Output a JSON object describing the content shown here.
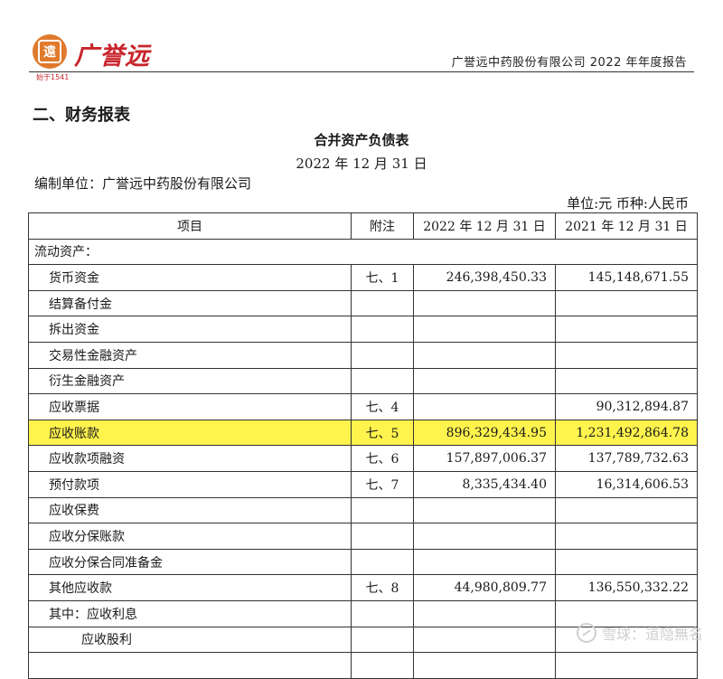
{
  "header": {
    "logo_mark": "遠",
    "logo_text": "广誉远",
    "logo_est": "始于1541",
    "report_title": "广誉远中药股份有限公司 2022 年年度报告"
  },
  "section_title": "二、财务报表",
  "document": {
    "title": "合并资产负债表",
    "date": "2022 年 12 月 31 日",
    "unit_line": "编制单位：广誉远中药股份有限公司",
    "currency_line": "单位:元  币种:人民币"
  },
  "table": {
    "headers": [
      "项目",
      "附注",
      "2022 年 12 月 31 日",
      "2021 年 12 月 31 日"
    ],
    "rows": [
      {
        "item": "流动资产：",
        "note": "",
        "v2022": "",
        "v2021": "",
        "kind": "section"
      },
      {
        "item": "货币资金",
        "note": "七、1",
        "v2022": "246,398,450.33",
        "v2021": "145,148,671.55",
        "kind": "normal"
      },
      {
        "item": "结算备付金",
        "note": "",
        "v2022": "",
        "v2021": "",
        "kind": "normal"
      },
      {
        "item": "拆出资金",
        "note": "",
        "v2022": "",
        "v2021": "",
        "kind": "normal"
      },
      {
        "item": "交易性金融资产",
        "note": "",
        "v2022": "",
        "v2021": "",
        "kind": "normal"
      },
      {
        "item": "衍生金融资产",
        "note": "",
        "v2022": "",
        "v2021": "",
        "kind": "normal"
      },
      {
        "item": "应收票据",
        "note": "七、4",
        "v2022": "",
        "v2021": "90,312,894.87",
        "kind": "normal"
      },
      {
        "item": "应收账款",
        "note": "七、5",
        "v2022": "896,329,434.95",
        "v2021": "1,231,492,864.78",
        "kind": "highlight"
      },
      {
        "item": "应收款项融资",
        "note": "七、6",
        "v2022": "157,897,006.37",
        "v2021": "137,789,732.63",
        "kind": "normal"
      },
      {
        "item": "预付款项",
        "note": "七、7",
        "v2022": "8,335,434.40",
        "v2021": "16,314,606.53",
        "kind": "normal"
      },
      {
        "item": "应收保费",
        "note": "",
        "v2022": "",
        "v2021": "",
        "kind": "normal"
      },
      {
        "item": "应收分保账款",
        "note": "",
        "v2022": "",
        "v2021": "",
        "kind": "normal"
      },
      {
        "item": "应收分保合同准备金",
        "note": "",
        "v2022": "",
        "v2021": "",
        "kind": "normal"
      },
      {
        "item": "其他应收款",
        "note": "七、8",
        "v2022": "44,980,809.77",
        "v2021": "136,550,332.22",
        "kind": "normal"
      },
      {
        "item": "其中：应收利息",
        "note": "",
        "v2022": "",
        "v2021": "",
        "kind": "normal"
      },
      {
        "item": "应收股利",
        "note": "",
        "v2022": "",
        "v2021": "",
        "kind": "indent2"
      },
      {
        "item": "",
        "note": "",
        "v2022": "",
        "v2021": "",
        "kind": "normal"
      }
    ]
  },
  "watermark": "雪球：道隐無名",
  "colors": {
    "highlight": "#fff34d",
    "logo_red": "#c8262c",
    "logo_orange": "#e07a2c"
  }
}
